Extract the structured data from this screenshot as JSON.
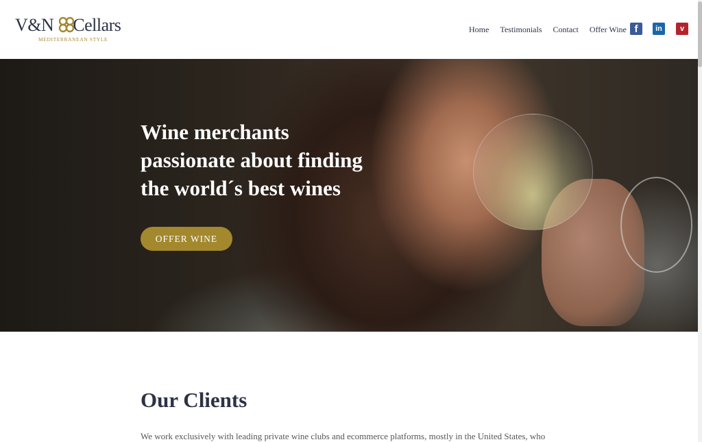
{
  "logo": {
    "text_left": "V&N",
    "text_right": "Cellars",
    "tagline": "MEDITERRANEAN STYLE"
  },
  "nav": {
    "items": [
      {
        "label": "Home"
      },
      {
        "label": "Testimonials"
      },
      {
        "label": "Contact"
      },
      {
        "label": "Offer Wine"
      }
    ]
  },
  "social": {
    "facebook_glyph": "f",
    "linkedin_glyph": "in",
    "vivino_glyph": "v"
  },
  "hero": {
    "title_lines": [
      "Wine merchants",
      "passionate about finding",
      "the world´s best wines"
    ],
    "button_label": "OFFER WINE"
  },
  "clients": {
    "title": "Our Clients",
    "text": "We work exclusively with leading private wine clubs and ecommerce platforms, mostly in the United States, who"
  },
  "colors": {
    "brand_navy": "#2d3346",
    "brand_gold": "#a3882e",
    "facebook": "#3b5a9a",
    "linkedin": "#1a66a8",
    "vivino": "#b3242c"
  }
}
